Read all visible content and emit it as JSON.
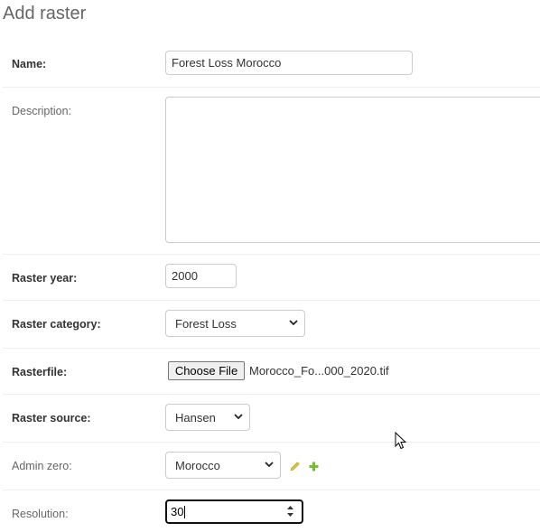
{
  "page": {
    "title": "Add raster"
  },
  "form": {
    "name": {
      "label": "Name:",
      "value": "Forest Loss Morocco"
    },
    "description": {
      "label": "Description:",
      "value": ""
    },
    "raster_year": {
      "label": "Raster year:",
      "value": "2000"
    },
    "raster_category": {
      "label": "Raster category:",
      "selected": "Forest Loss"
    },
    "rasterfile": {
      "label": "Rasterfile:",
      "button_label": "Choose File",
      "file_name": "Morocco_Fo...000_2020.tif"
    },
    "raster_source": {
      "label": "Raster source:",
      "selected": "Hansen"
    },
    "admin_zero": {
      "label": "Admin zero:",
      "selected": "Morocco",
      "change_icon": "pencil-icon",
      "add_icon": "plus-icon"
    },
    "resolution": {
      "label": "Resolution:",
      "value": "30"
    }
  },
  "colors": {
    "edit_icon": "#d9c43a",
    "add_icon": "#70bf2b",
    "row_border": "#eeeeee"
  }
}
